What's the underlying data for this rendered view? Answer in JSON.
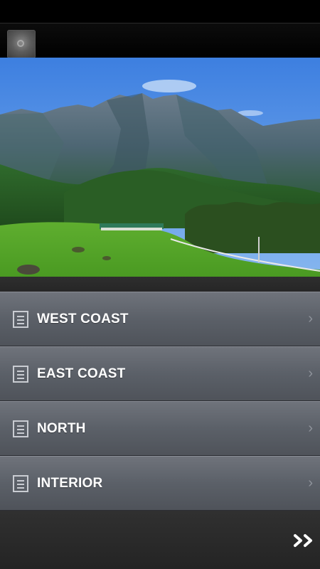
{
  "app": {
    "icon": "app-logo-icon",
    "hero_image": "mountain-landscape"
  },
  "menu": {
    "items": [
      {
        "label": "WEST COAST",
        "icon": "document-icon",
        "chevron": "›"
      },
      {
        "label": "EAST COAST",
        "icon": "document-icon",
        "chevron": "›"
      },
      {
        "label": "NORTH",
        "icon": "document-icon",
        "chevron": "›"
      },
      {
        "label": "INTERIOR",
        "icon": "document-icon",
        "chevron": "›"
      }
    ]
  },
  "footer": {
    "next_icon": "double-chevron-right-icon"
  },
  "colors": {
    "menu_item_top": "#6f737b",
    "menu_item_bottom": "#4f535a",
    "label": "#ffffff",
    "background": "#262626"
  }
}
